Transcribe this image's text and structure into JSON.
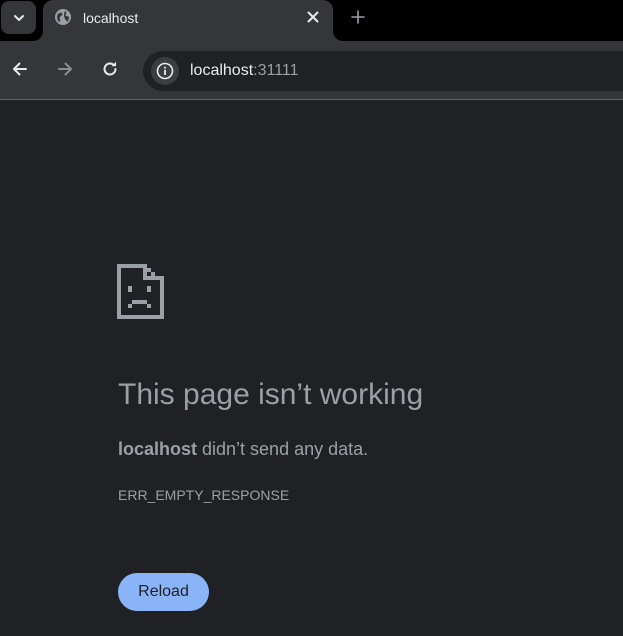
{
  "tabs": [
    {
      "title": "localhost",
      "favicon": "globe-icon",
      "active": true
    }
  ],
  "toolbar": {
    "back_icon": "arrow-left-icon",
    "forward_icon": "arrow-right-icon",
    "reload_icon": "reload-icon",
    "site_info_icon": "info-icon"
  },
  "address_bar": {
    "host": "localhost",
    "port": ":31111"
  },
  "error_page": {
    "icon": "sad-page-icon",
    "title": "This page isn’t working",
    "message_host": "localhost",
    "message_rest": " didn’t send any data.",
    "error_code": "ERR_EMPTY_RESPONSE",
    "reload_label": "Reload"
  },
  "colors": {
    "page_background": "#202124",
    "toolbar_background": "#35363a",
    "tabstrip_background": "#000000",
    "text_secondary": "#9aa0a6",
    "button_accent": "#8ab4f8"
  }
}
